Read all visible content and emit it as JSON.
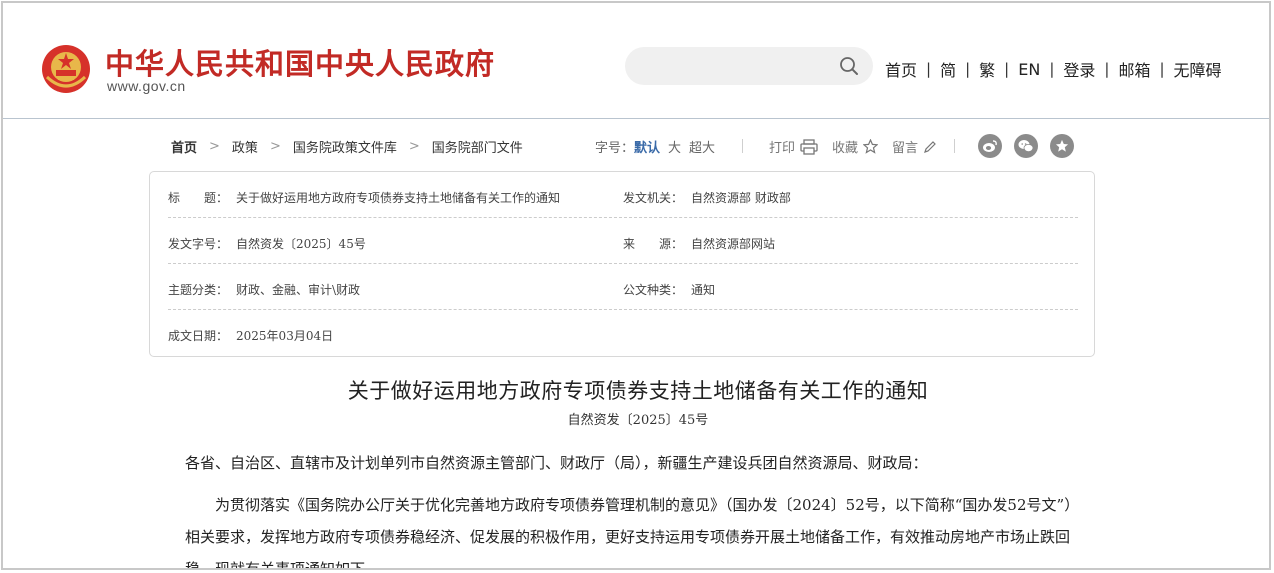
{
  "header": {
    "site_title": "中华人民共和国中央人民政府",
    "site_url": "www.gov.cn",
    "search": {
      "placeholder": "",
      "value": ""
    },
    "nav": [
      {
        "label": "首页"
      },
      {
        "label": "简"
      },
      {
        "label": "繁"
      },
      {
        "label": "EN"
      },
      {
        "label": "登录"
      },
      {
        "label": "邮箱"
      },
      {
        "label": "无障碍"
      }
    ],
    "nav_separator": "|"
  },
  "breadcrumb": [
    "首页",
    "政策",
    "国务院政策文件库",
    "国务院部门文件"
  ],
  "breadcrumb_arrow": ">",
  "font_size": {
    "label": "字号：",
    "options": [
      "默认",
      "大",
      "超大"
    ],
    "selected": "默认"
  },
  "tools": {
    "print": "打印",
    "favorite": "收藏",
    "comment": "留言"
  },
  "share": [
    "weibo-icon",
    "wechat-icon",
    "favorites-star-icon"
  ],
  "info": {
    "title_label": "标　　题：",
    "title_value": "关于做好运用地方政府专项债券支持土地储备有关工作的通知",
    "issuer_label": "发文机关：",
    "issuer_value": "自然资源部 财政部",
    "docno_label": "发文字号：",
    "docno_value": "自然资发〔2025〕45号",
    "source_label": "来　　源：",
    "source_value": "自然资源部网站",
    "topic_label": "主题分类：",
    "topic_value": "财政、金融、审计\\财政",
    "type_label": "公文种类：",
    "type_value": "通知",
    "date_label": "成文日期：",
    "date_value": "2025年03月04日"
  },
  "article": {
    "title": "关于做好运用地方政府专项债券支持土地储备有关工作的通知",
    "doc_number": "自然资发〔2025〕45号",
    "salutation": "各省、自治区、直辖市及计划单列市自然资源主管部门、财政厅（局），新疆生产建设兵团自然资源局、财政局：",
    "paragraph_1": "为贯彻落实《国务院办公厅关于优化完善地方政府专项债券管理机制的意见》（国办发〔2024〕52号，以下简称“国办发52号文”）相关要求，发挥地方政府专项债券稳经济、促发展的积极作用，更好支持运用专项债券开展土地储备工作，有效推动房地产市场止跌回稳。现就有关事项通知如下。"
  },
  "colors": {
    "brand_red": "#c22a25",
    "link_blue": "#3a6aa8",
    "share_gray": "#8b8b8b"
  }
}
